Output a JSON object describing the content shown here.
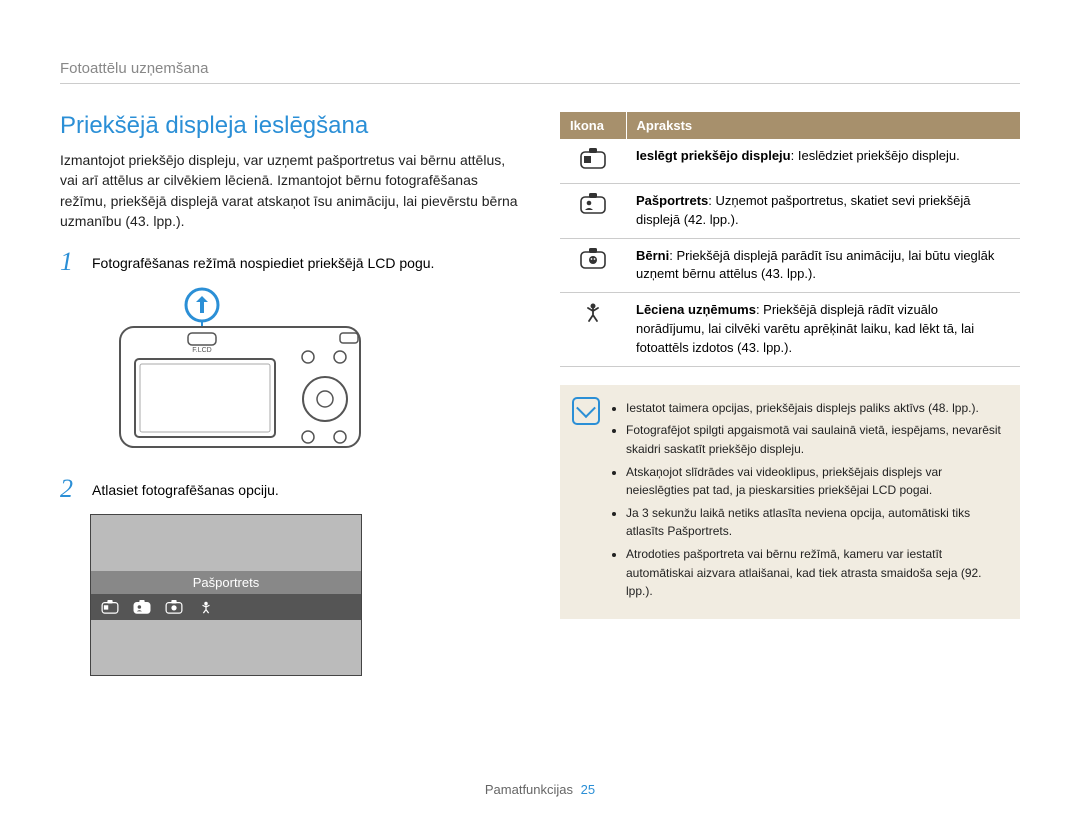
{
  "section_header": "Fotoattēlu uzņemšana",
  "title": "Priekšējā displeja ieslēgšana",
  "intro": "Izmantojot priekšējo displeju, var uzņemt pašportretus vai bērnu attēlus, vai arī attēlus ar cilvēkiem lēcienā. Izmantojot bērnu fotografēšanas režīmu, priekšējā displejā varat atskaņot īsu animāciju, lai pievērstu bērna uzmanību (43. lpp.).",
  "steps": {
    "s1": {
      "num": "1",
      "text": "Fotografēšanas režīmā nospiediet priekšējā LCD pogu."
    },
    "s2": {
      "num": "2",
      "text": "Atlasiet fotografēšanas opciju."
    }
  },
  "camera_label": "F.LCD",
  "display_label": "Pašportrets",
  "table": {
    "head_icon": "Ikona",
    "head_desc": "Apraksts",
    "rows": [
      {
        "desc_bold": "Ieslēgt priekšējo displeju",
        "desc_rest": ": Ieslēdziet priekšējo displeju."
      },
      {
        "desc_bold": "Pašportrets",
        "desc_rest": ": Uzņemot pašportretus, skatiet sevi priekšējā displejā (42. lpp.)."
      },
      {
        "desc_bold": "Bērni",
        "desc_rest": ": Priekšējā displejā parādīt īsu animāciju, lai būtu vieglāk uzņemt bērnu attēlus (43. lpp.)."
      },
      {
        "desc_bold": "Lēciena uzņēmums",
        "desc_rest": ": Priekšējā displejā rādīt vizuālo norādījumu, lai cilvēki varētu aprēķināt laiku, kad lēkt tā, lai fotoattēls izdotos (43. lpp.)."
      }
    ]
  },
  "notes": [
    "Iestatot taimera opcijas, priekšējais displejs paliks aktīvs (48. lpp.).",
    "Fotografējot spilgti apgaismotā vai saulainā vietā, iespējams, nevarēsit skaidri saskatīt priekšējo displeju.",
    "Atskaņojot slīdrādes vai videoklipus, priekšējais displejs var neieslēgties pat tad, ja pieskarsities priekšējai LCD pogai.",
    "Ja 3 sekunžu laikā netiks atlasīta neviena opcija, automātiski tiks atlasīts Pašportrets.",
    "Atrodoties pašportreta vai bērnu režīmā, kameru var iestatīt automātiskai aizvara atlaišanai, kad tiek atrasta smaidoša seja (92. lpp.)."
  ],
  "footer_text": "Pamatfunkcijas",
  "footer_page": "25"
}
